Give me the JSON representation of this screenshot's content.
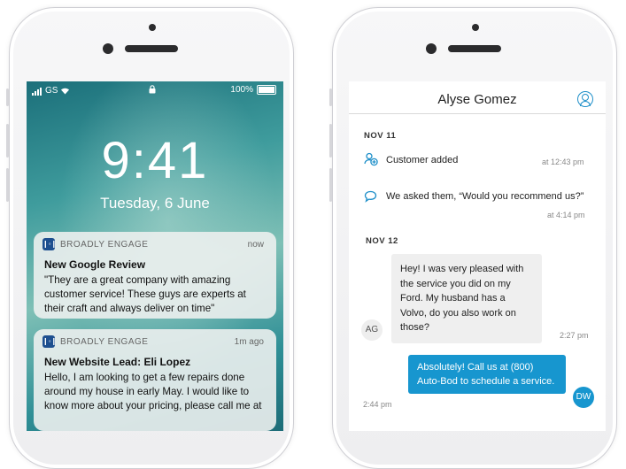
{
  "lock_screen": {
    "status": {
      "carrier": "GS",
      "battery": "100%"
    },
    "time": "9:41",
    "date": "Tuesday, 6 June",
    "notifications": [
      {
        "app": "BROADLY ENGAGE",
        "ago": "now",
        "title": "New Google Review",
        "body": "\"They are a great company with amazing customer service! These guys are experts at their craft and always deliver on time\""
      },
      {
        "app": "BROADLY ENGAGE",
        "ago": "1m ago",
        "title": "New Website Lead: Eli Lopez",
        "body": "Hello, I am looking to get a few repairs done around my house in early May. I would like to know more about your pricing, please call me at"
      }
    ]
  },
  "chat": {
    "title": "Alyse Gomez",
    "day1": "NOV 11",
    "event1": {
      "text": "Customer added",
      "time": "at 12:43 pm"
    },
    "event2": {
      "text": "We asked them, “Would you recommend us?”",
      "time": "at 4:14 pm"
    },
    "day2": "NOV 12",
    "incoming": {
      "text": "Hey! I was very pleased with the service you did on my Ford. My husband has a Volvo, do you also work on those?",
      "time": "2:27 pm",
      "initials": "AG"
    },
    "outgoing": {
      "text": "Absolutely! Call us at (800) Auto-Bod to schedule a service.",
      "time": "2:44 pm",
      "initials": "DW"
    }
  },
  "colors": {
    "accent": "#1796cf",
    "wallpaper": "#2f8f96"
  }
}
